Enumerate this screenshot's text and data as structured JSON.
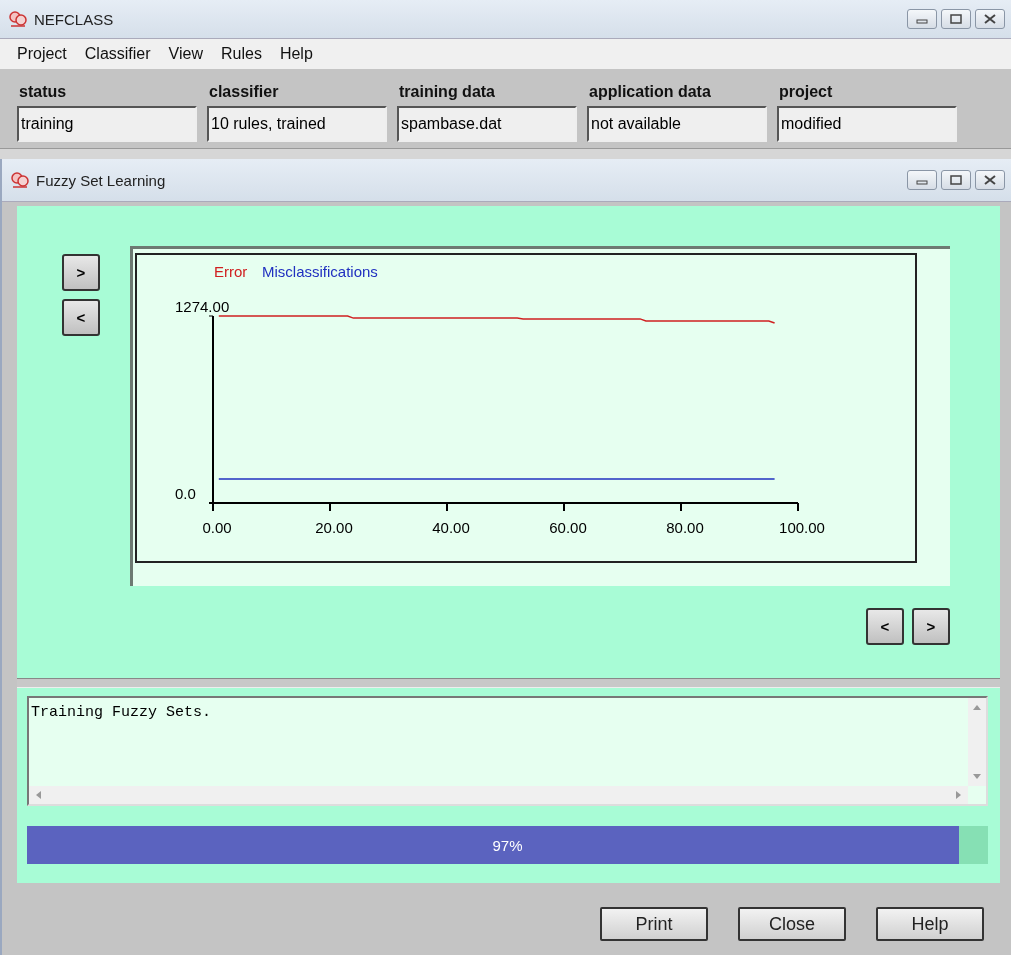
{
  "app_window": {
    "title": "NEFCLASS"
  },
  "menu": [
    "Project",
    "Classifier",
    "View",
    "Rules",
    "Help"
  ],
  "status_fields": [
    {
      "label": "status",
      "value": "training"
    },
    {
      "label": "classifier",
      "value": "10 rules, trained"
    },
    {
      "label": "training data",
      "value": "spambase.dat"
    },
    {
      "label": "application data",
      "value": "not available"
    },
    {
      "label": "project",
      "value": "modified"
    }
  ],
  "dialog": {
    "title": "Fuzzy Set Learning",
    "left_nav": [
      ">",
      "<"
    ],
    "right_nav": [
      "<",
      ">"
    ],
    "chart_data": {
      "type": "line",
      "x": [
        1,
        23,
        24,
        52,
        53,
        73,
        74,
        95,
        96
      ],
      "series": [
        {
          "name": "Error",
          "color": "#d02020",
          "values": [
            1274,
            1274,
            1260,
            1260,
            1254,
            1254,
            1240,
            1240,
            1226
          ]
        },
        {
          "name": "Misclassifications",
          "color": "#2030c0",
          "values": [
            164,
            164,
            164,
            164,
            164,
            164,
            164,
            164,
            164
          ]
        }
      ],
      "xlim": [
        0,
        100
      ],
      "ylim": [
        0,
        1274
      ],
      "xticks": [
        {
          "value": 0,
          "label": "0.00"
        },
        {
          "value": 20,
          "label": "20.00"
        },
        {
          "value": 40,
          "label": "40.00"
        },
        {
          "value": 60,
          "label": "60.00"
        },
        {
          "value": 80,
          "label": "80.00"
        },
        {
          "value": 100,
          "label": "100.00"
        }
      ],
      "yticks": [
        {
          "value": 0,
          "label": "0.0"
        },
        {
          "value": 1274,
          "label": "1274.00"
        }
      ]
    },
    "log_text": "Training Fuzzy Sets.",
    "progress": {
      "level": 0.97,
      "reading": "97%"
    },
    "buttons": [
      "Print",
      "Close",
      "Help"
    ]
  }
}
